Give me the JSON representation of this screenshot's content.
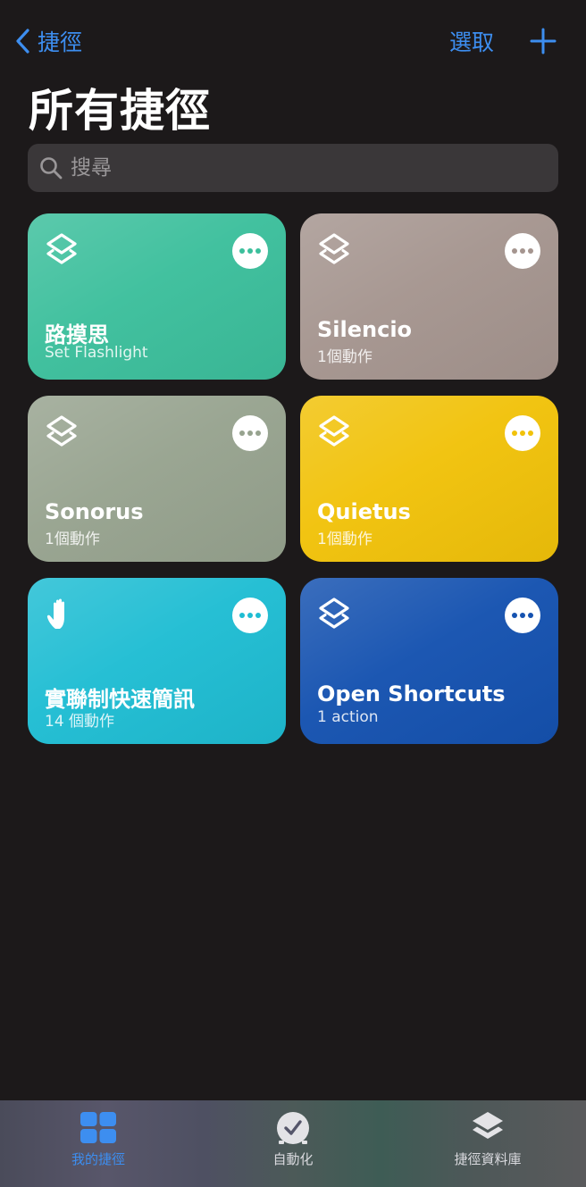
{
  "nav": {
    "back_label": "捷徑",
    "select_label": "選取"
  },
  "page": {
    "title": "所有捷徑"
  },
  "search": {
    "placeholder": "搜尋"
  },
  "shortcuts": [
    {
      "name": "路摸思",
      "subtitle": "Set Flashlight",
      "color": "#3cbf9c",
      "icon": "layers-icon"
    },
    {
      "name": "Silencio",
      "subtitle": "1個動作",
      "color": "#a5958f",
      "icon": "layers-icon"
    },
    {
      "name": "Sonorus",
      "subtitle": "1個動作",
      "color": "#97a38f",
      "icon": "layers-icon"
    },
    {
      "name": "Quietus",
      "subtitle": "1個動作",
      "color": "#f1c20a",
      "icon": "layers-icon"
    },
    {
      "name": "實聯制快速簡訊",
      "subtitle": "14 個動作",
      "color": "#1fbdd3",
      "icon": "hand-icon"
    },
    {
      "name": "Open Shortcuts",
      "subtitle": "1 action",
      "color": "#1552b0",
      "icon": "layers-icon"
    }
  ],
  "tabs": [
    {
      "label": "我的捷徑",
      "icon": "grid-icon",
      "active": true
    },
    {
      "label": "自動化",
      "icon": "clock-check-icon",
      "active": false
    },
    {
      "label": "捷徑資料庫",
      "icon": "layers-icon",
      "active": false
    }
  ],
  "colors": {
    "accent": "#3d8ef0",
    "background": "#1c191a",
    "search_bg": "#3a3739"
  }
}
